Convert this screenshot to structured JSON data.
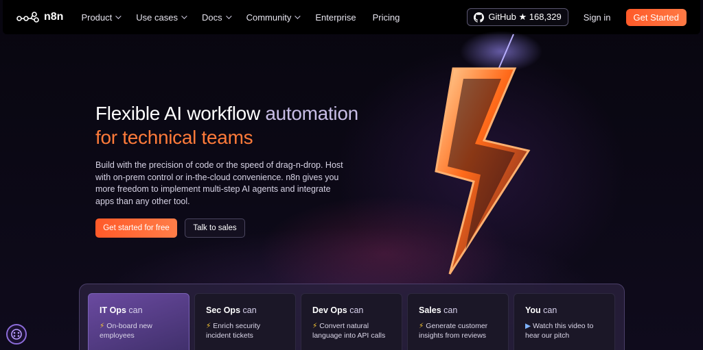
{
  "nav": {
    "logo_text": "n8n",
    "items": [
      {
        "label": "Product",
        "dropdown": true
      },
      {
        "label": "Use cases",
        "dropdown": true
      },
      {
        "label": "Docs",
        "dropdown": true
      },
      {
        "label": "Community",
        "dropdown": true
      },
      {
        "label": "Enterprise",
        "dropdown": false
      },
      {
        "label": "Pricing",
        "dropdown": false
      }
    ],
    "github_label": "GitHub ★ 168,329",
    "signin": "Sign in",
    "cta": "Get Started"
  },
  "hero": {
    "title_white": "Flexible AI workflow ",
    "title_purple": "automation",
    "title_orange": "for technical teams",
    "description": "Build with the precision of code or the speed of drag-n-drop. Host with on-prem control or in-the-cloud convenience. n8n gives you more freedom to implement multi-step AI agents and integrate apps than any other tool.",
    "primary_button": "Get started for free",
    "secondary_button": "Talk to sales"
  },
  "cards": [
    {
      "title": "IT Ops",
      "suffix": " can",
      "icon": "⚡",
      "text": "On-board new employees",
      "active": true
    },
    {
      "title": "Sec Ops",
      "suffix": " can",
      "icon": "⚡",
      "text": "Enrich security incident tickets",
      "active": false
    },
    {
      "title": "Dev Ops",
      "suffix": " can",
      "icon": "⚡",
      "text": "Convert natural language into API calls",
      "active": false
    },
    {
      "title": "Sales",
      "suffix": " can",
      "icon": "⚡",
      "text": "Generate customer insights from reviews",
      "active": false
    },
    {
      "title": "You",
      "suffix": " can",
      "icon": "▶",
      "text": "Watch this video to hear our pitch",
      "active": false
    }
  ],
  "colors": {
    "accent": "#ff6b3d",
    "purple": "#c8bde6",
    "orange": "#ff7b3a",
    "background": "#0b0914"
  }
}
